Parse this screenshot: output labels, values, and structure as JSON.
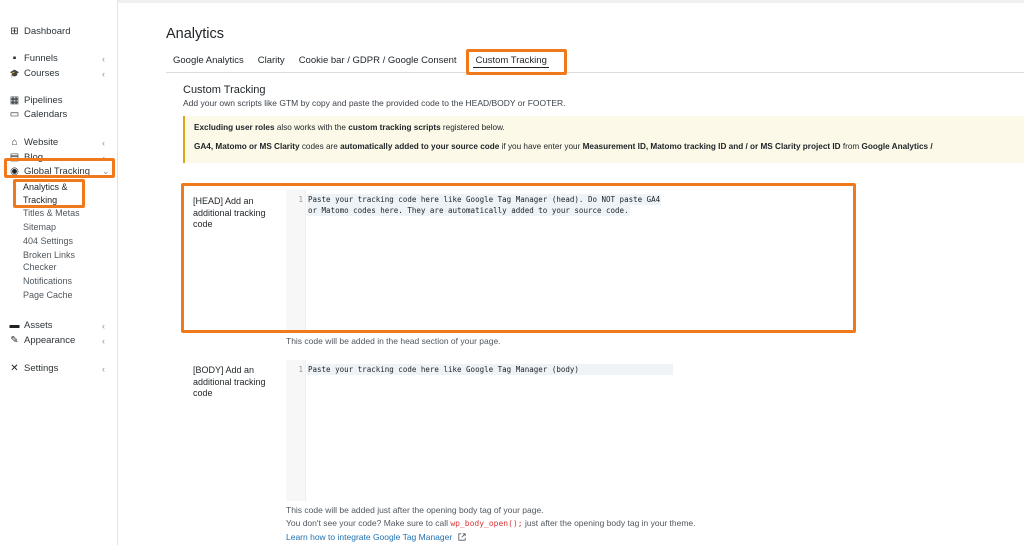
{
  "sidebar": {
    "items": [
      {
        "label": "Dashboard",
        "icon": "dashboard-icon",
        "glyph": "⊞",
        "chevron": ""
      },
      {
        "label": "Funnels",
        "icon": "funnels-icon",
        "glyph": "▪",
        "chevron": "‹"
      },
      {
        "label": "Courses",
        "icon": "courses-icon",
        "glyph": "🎓",
        "chevron": "‹"
      },
      {
        "label": "Pipelines",
        "icon": "pipelines-icon",
        "glyph": "▦",
        "chevron": ""
      },
      {
        "label": "Calendars",
        "icon": "calendars-icon",
        "glyph": "▭",
        "chevron": ""
      },
      {
        "label": "Website",
        "icon": "website-icon",
        "glyph": "⌂",
        "chevron": "‹"
      },
      {
        "label": "Blog",
        "icon": "blog-icon",
        "glyph": "▤",
        "chevron": "‹"
      },
      {
        "label": "Global Tracking",
        "icon": "global-tracking-icon",
        "glyph": "◉",
        "chevron": "⌄"
      },
      {
        "label": "Assets",
        "icon": "assets-icon",
        "glyph": "▬",
        "chevron": "‹"
      },
      {
        "label": "Appearance",
        "icon": "appearance-icon",
        "glyph": "✎",
        "chevron": "‹"
      },
      {
        "label": "Settings",
        "icon": "settings-icon",
        "glyph": "✕",
        "chevron": "‹"
      }
    ],
    "sub_items": [
      "Analytics &",
      "Tracking",
      "Titles & Metas",
      "Sitemap",
      "404 Settings",
      "Broken Links",
      "Checker",
      "Notifications",
      "Page Cache"
    ]
  },
  "page": {
    "title": "Analytics",
    "tabs": [
      "Google Analytics",
      "Clarity",
      "Cookie bar / GDPR / Google Consent",
      "Custom Tracking"
    ],
    "active_tab": "Custom Tracking"
  },
  "section": {
    "title": "Custom Tracking",
    "description": "Add your own scripts like GTM by copy and paste the provided code to the HEAD/BODY or FOOTER."
  },
  "notice": {
    "line1_bold1": "Excluding user roles",
    "line1_text1": " also works with the ",
    "line1_bold2": "custom tracking scripts",
    "line1_text2": " registered below.",
    "line2_bold1": "GA4, Matomo or MS Clarity",
    "line2_text1": " codes are ",
    "line2_bold2": "automatically added to your source code",
    "line2_text2": " if you have enter your ",
    "line2_bold3": "Measurement ID, Matomo tracking ID and / or MS Clarity project ID",
    "line2_text3": " from ",
    "line2_bold4": "Google Analytics /"
  },
  "head_field": {
    "label": "[HEAD] Add an additional tracking code",
    "line_number": "1",
    "code_line1": "Paste your tracking code here like Google Tag Manager (head). Do NOT paste GA4",
    "code_line2": "or Matomo codes here. They are automatically added to your source code.",
    "hint": "This code will be added in the head section of your page."
  },
  "body_field": {
    "label": "[BODY] Add an additional tracking code",
    "line_number": "1",
    "code_line1": "Paste your tracking code here like Google Tag Manager (body)",
    "hint1": "This code will be added just after the opening body tag of your page.",
    "hint2_before": "You don't see your code? Make sure to call ",
    "hint2_code": "wp_body_open();",
    "hint2_after": " just after the opening body tag in your theme.",
    "link": "Learn how to integrate Google Tag Manager",
    "link_icon": "external-link-icon"
  },
  "colors": {
    "highlight": "#f07a1b",
    "notice_bg": "#fcf9e8",
    "notice_border": "#dba617",
    "link": "#2271b1",
    "code_red": "#d63638"
  }
}
